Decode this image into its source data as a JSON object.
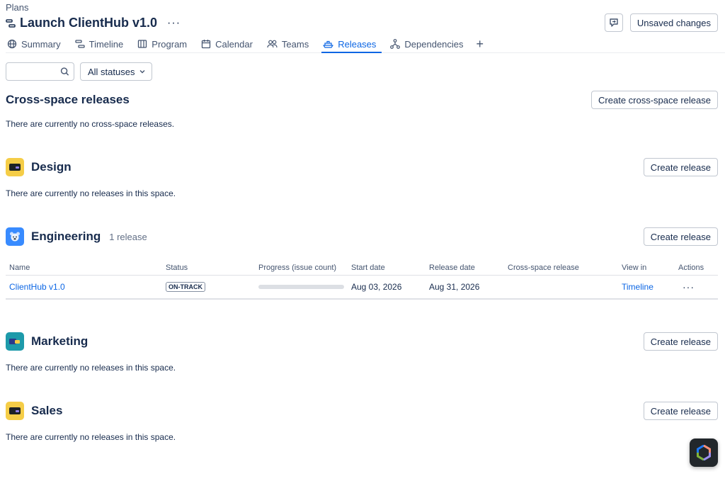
{
  "breadcrumb": "Plans",
  "title": "Launch ClientHub v1.0",
  "more_label": "···",
  "top_actions": {
    "unsaved_label": "Unsaved changes"
  },
  "tabs": [
    {
      "label": "Summary",
      "icon": "globe-icon"
    },
    {
      "label": "Timeline",
      "icon": "timeline-icon"
    },
    {
      "label": "Program",
      "icon": "program-icon"
    },
    {
      "label": "Calendar",
      "icon": "calendar-icon"
    },
    {
      "label": "Teams",
      "icon": "teams-icon"
    },
    {
      "label": "Releases",
      "icon": "ship-icon",
      "active": true
    },
    {
      "label": "Dependencies",
      "icon": "dependencies-icon"
    }
  ],
  "add_tab_label": "+",
  "filters": {
    "search_placeholder": "",
    "search_value": "",
    "status_select": "All statuses"
  },
  "cross_space": {
    "title": "Cross-space releases",
    "button": "Create cross-space release",
    "empty": "There are currently no cross-space releases."
  },
  "spaces": [
    {
      "name": "Design",
      "button": "Create release",
      "empty": "There are currently no releases in this space.",
      "icon_color": "#f5cd47"
    },
    {
      "name": "Engineering",
      "count": "1 release",
      "button": "Create release",
      "icon_color": "#388bff"
    },
    {
      "name": "Marketing",
      "button": "Create release",
      "empty": "There are currently no releases in this space.",
      "icon_color": "#1d9aaa"
    },
    {
      "name": "Sales",
      "button": "Create release",
      "empty": "There are currently no releases in this space.",
      "icon_color": "#f5cd47"
    }
  ],
  "release_table": {
    "headers": [
      "Name",
      "Status",
      "Progress (issue count)",
      "Start date",
      "Release date",
      "Cross-space release",
      "View in",
      "Actions"
    ],
    "rows": [
      {
        "name": "ClientHub v1.0",
        "status": "ON-TRACK",
        "progress": 0,
        "start": "Aug 03, 2026",
        "release": "Aug 31, 2026",
        "cross_space": "",
        "view_in": "Timeline",
        "actions": "···"
      }
    ]
  },
  "colors": {
    "accent": "#0c66e4",
    "text": "#172b4d"
  }
}
